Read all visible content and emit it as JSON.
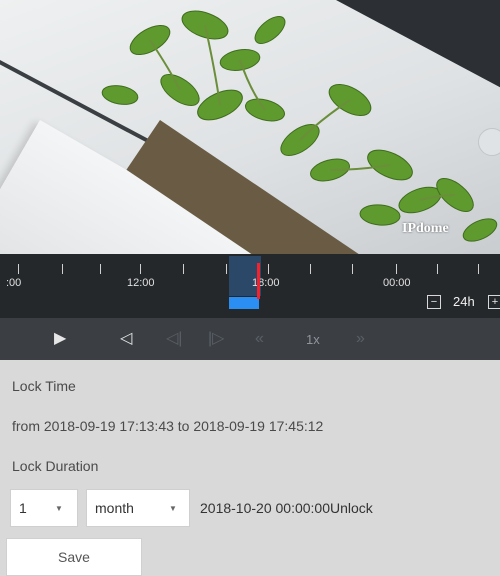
{
  "video": {
    "watermark": "IPdome"
  },
  "timeline": {
    "labels": [
      ":00",
      "12:00",
      "18:00",
      "00:00"
    ],
    "zoom_minus": "−",
    "zoom_level": "24h",
    "zoom_plus": "+"
  },
  "controls": {
    "play_icon": "play-icon",
    "speed": "1x"
  },
  "lock": {
    "lock_time_label": "Lock Time",
    "lock_time_range": "from 2018-09-19 17:13:43 to 2018-09-19 17:45:12",
    "lock_duration_label": "Lock Duration",
    "duration_value": "1",
    "duration_unit": "month",
    "unlock_text": "2018-10-20 00:00:00Unlock",
    "save_label": "Save"
  },
  "colors": {
    "timeline_bg": "#25282b",
    "controls_bg": "#3b3f44",
    "recording": "#2a8ef3",
    "cursor": "#f5222d",
    "panel_bg": "#d9d9d9"
  }
}
